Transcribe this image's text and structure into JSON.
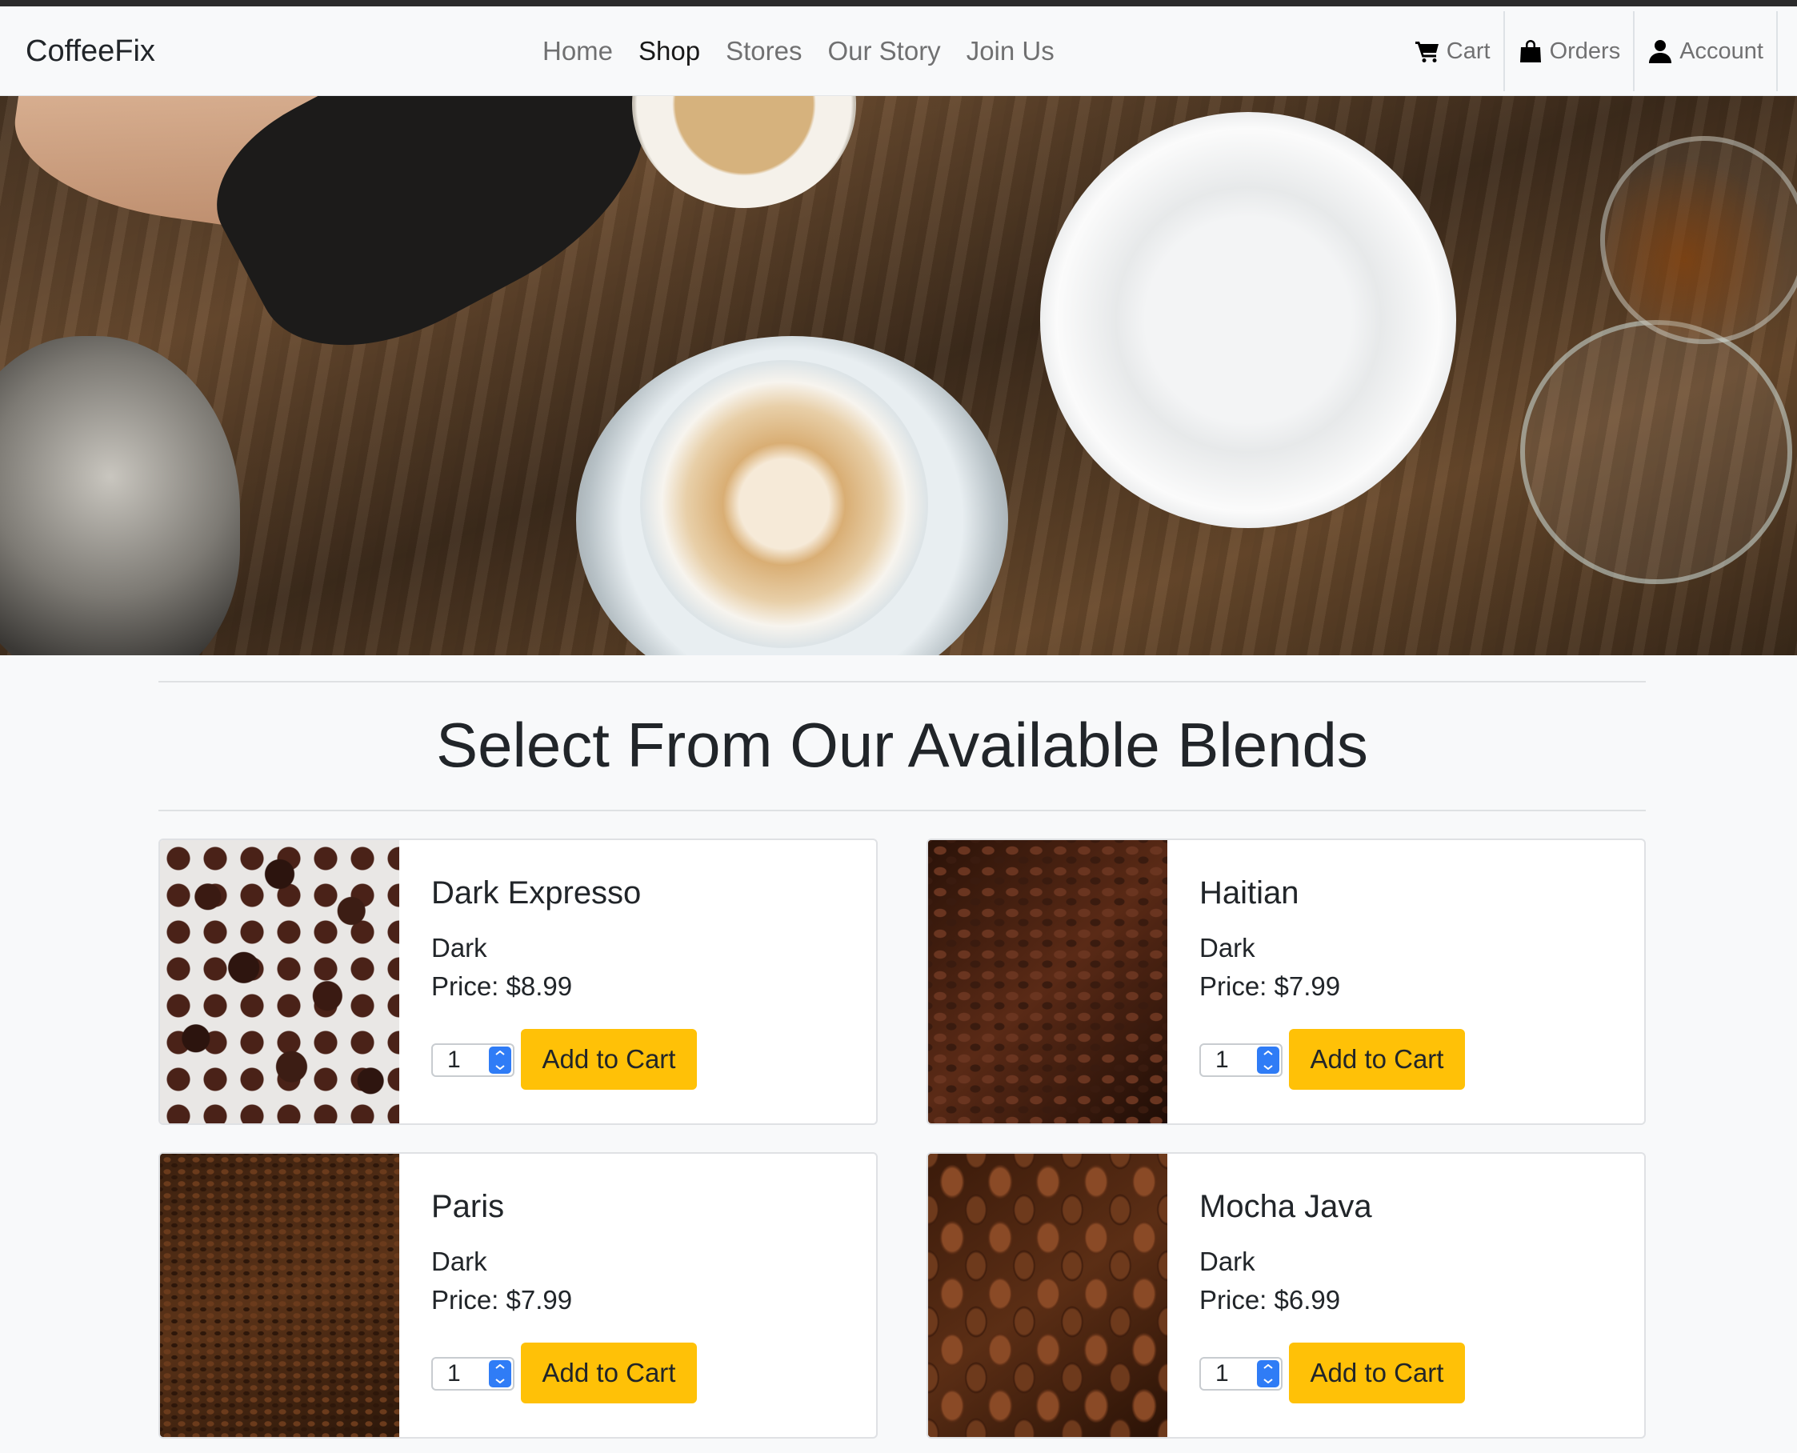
{
  "nav": {
    "brand": "CoffeeFix",
    "links": [
      {
        "label": "Home",
        "active": false
      },
      {
        "label": "Shop",
        "active": true
      },
      {
        "label": "Stores",
        "active": false
      },
      {
        "label": "Our Story",
        "active": false
      },
      {
        "label": "Join Us",
        "active": false
      }
    ],
    "right": [
      {
        "label": "Cart",
        "icon": "cart-icon"
      },
      {
        "label": "Orders",
        "icon": "shopping-bag-icon"
      },
      {
        "label": "Account",
        "icon": "user-icon"
      }
    ]
  },
  "hero": {
    "image": "coffee-table-latte-photo"
  },
  "heading": "Select From Our Available Blends",
  "products": [
    {
      "name": "Dark Expresso",
      "roast": "Dark",
      "price": "Price: $8.99",
      "qty": "1",
      "button": "Add to Cart",
      "image": "chocolate-covered-beans"
    },
    {
      "name": "Haitian",
      "roast": "Dark",
      "price": "Price: $7.99",
      "qty": "1",
      "button": "Add to Cart",
      "image": "roasted-beans-dark"
    },
    {
      "name": "Paris",
      "roast": "Dark",
      "price": "Price: $7.99",
      "qty": "1",
      "button": "Add to Cart",
      "image": "roasted-beans-small"
    },
    {
      "name": "Mocha Java",
      "roast": "Dark",
      "price": "Price: $6.99",
      "qty": "1",
      "button": "Add to Cart",
      "image": "roasted-beans-large"
    }
  ],
  "colors": {
    "accent": "#ffc107",
    "spinner": "#2f7cf6",
    "background": "#f8f9fa"
  }
}
